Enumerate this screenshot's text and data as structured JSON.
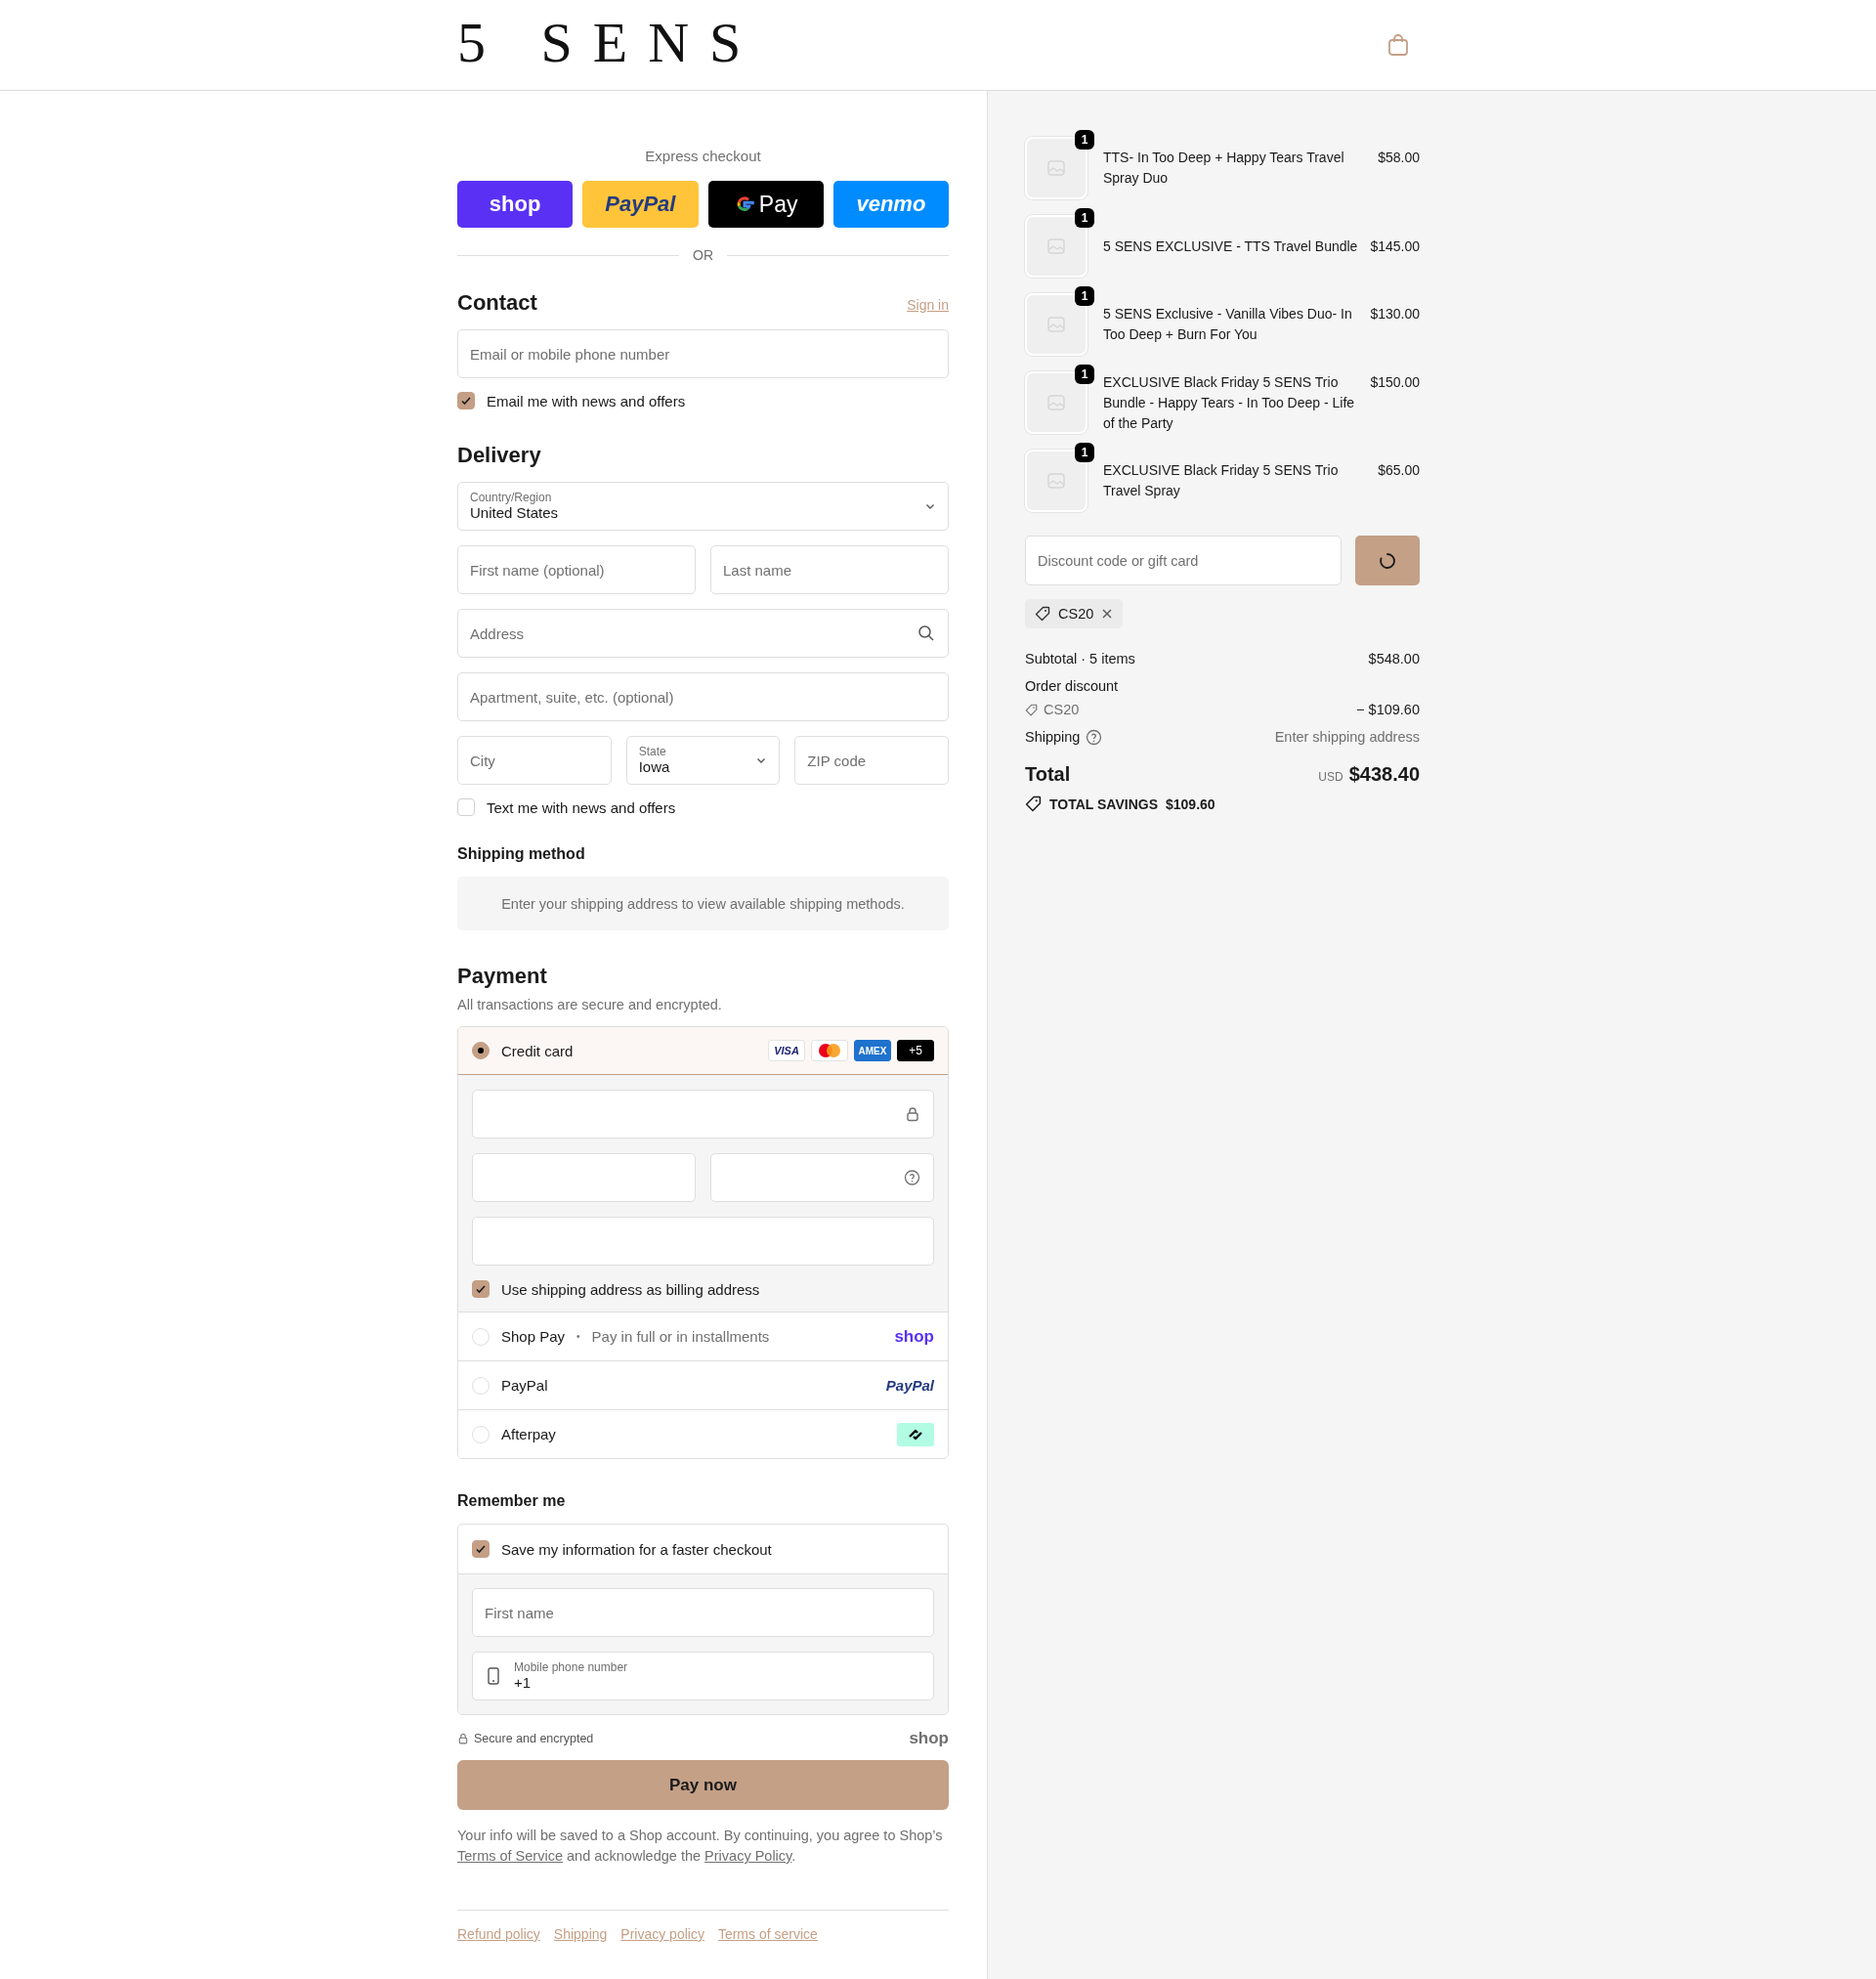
{
  "header": {
    "logo": "5 SENS"
  },
  "express_checkout": {
    "label": "Express checkout",
    "divider": "OR",
    "buttons": [
      {
        "kind": "shop",
        "label": "shop"
      },
      {
        "kind": "paypal",
        "label": "PayPal"
      },
      {
        "kind": "gpay",
        "label": "Pay"
      },
      {
        "kind": "venmo",
        "label": "venmo"
      }
    ]
  },
  "contact": {
    "title": "Contact",
    "sign_in": "Sign in",
    "email": {
      "placeholder": "Email or mobile phone number"
    },
    "news": {
      "label": "Email me with news and offers",
      "checked": true
    }
  },
  "delivery": {
    "title": "Delivery",
    "rows": [
      {
        "fields": [
          {
            "kind": "select",
            "label": "Country/Region",
            "value": "United States"
          }
        ]
      },
      {
        "fields": [
          {
            "kind": "text",
            "placeholder": "First name (optional)"
          },
          {
            "kind": "text",
            "placeholder": "Last name"
          }
        ]
      },
      {
        "fields": [
          {
            "kind": "search",
            "placeholder": "Address"
          }
        ]
      },
      {
        "fields": [
          {
            "kind": "text",
            "placeholder": "Apartment, suite, etc. (optional)"
          }
        ]
      },
      {
        "fields": [
          {
            "kind": "text",
            "placeholder": "City"
          },
          {
            "kind": "select",
            "label": "State",
            "value": "Iowa"
          },
          {
            "kind": "text",
            "placeholder": "ZIP code"
          }
        ]
      }
    ],
    "sms": {
      "label": "Text me with news and offers",
      "checked": false
    }
  },
  "shipping_method": {
    "title": "Shipping method",
    "message": "Enter your shipping address to view available shipping methods."
  },
  "payment": {
    "title": "Payment",
    "subtitle": "All transactions are secure and encrypted.",
    "methods": [
      {
        "kind": "card",
        "label": "Credit card",
        "selected": true,
        "badges": [
          {
            "kind": "visa",
            "text": "VISA"
          },
          {
            "kind": "mastercard"
          },
          {
            "kind": "amex",
            "text": "AMEX"
          },
          {
            "kind": "more",
            "text": "+5"
          }
        ],
        "field_rows": [
          {
            "fields": [
              {
                "kind": "lock"
              }
            ]
          },
          {
            "fields": [
              {
                "kind": "plain"
              },
              {
                "kind": "help"
              }
            ]
          },
          {
            "fields": [
              {
                "kind": "plain"
              }
            ]
          }
        ],
        "billing": {
          "label": "Use shipping address as billing address",
          "checked": true
        }
      },
      {
        "kind": "shop_pay",
        "label": "Shop Pay",
        "selected": false,
        "separator": "•",
        "note": "Pay in full or in installments",
        "logo": "shop"
      },
      {
        "kind": "paypal",
        "label": "PayPal",
        "selected": false,
        "logo": "PayPal"
      },
      {
        "kind": "afterpay",
        "label": "Afterpay",
        "selected": false
      }
    ]
  },
  "remember_me": {
    "title": "Remember me",
    "save": {
      "label": "Save my information for a faster checkout",
      "checked": true
    },
    "first_name": {
      "placeholder": "First name"
    },
    "phone": {
      "label": "Mobile phone number",
      "value": "+1"
    },
    "secure": "Secure and encrypted",
    "shop_logo": "shop"
  },
  "pay_button": "Pay now",
  "disclaimer": [
    {
      "kind": "text",
      "text": "Your info will be saved to a Shop account. By continuing, you agree to Shop’s "
    },
    {
      "kind": "link",
      "text": "Terms of Service"
    },
    {
      "kind": "text",
      "text": " and acknowledge the "
    },
    {
      "kind": "link",
      "text": "Privacy Policy"
    },
    {
      "kind": "text",
      "text": "."
    }
  ],
  "footer_links": [
    "Refund policy",
    "Shipping",
    "Privacy policy",
    "Terms of service"
  ],
  "summary": {
    "items": [
      {
        "name": "TTS- In Too Deep + Happy Tears Travel Spray Duo",
        "price": "$58.00",
        "quantity": "1"
      },
      {
        "name": "5 SENS EXCLUSIVE - TTS Travel Bundle",
        "price": "$145.00",
        "quantity": "1"
      },
      {
        "name": "5 SENS Exclusive - Vanilla Vibes Duo- In Too Deep + Burn For You",
        "price": "$130.00",
        "quantity": "1"
      },
      {
        "name": "EXCLUSIVE Black Friday 5 SENS Trio Bundle - Happy Tears - In Too Deep - Life of the Party",
        "price": "$150.00",
        "quantity": "1"
      },
      {
        "name": "EXCLUSIVE Black Friday 5 SENS Trio Travel Spray",
        "price": "$65.00",
        "quantity": "1"
      }
    ],
    "discount": {
      "placeholder": "Discount code or gift card",
      "applied_code": "CS20"
    },
    "subtotal": {
      "label": "Subtotal · 5 items",
      "value": "$548.00"
    },
    "order_discount": {
      "label": "Order discount",
      "code": "CS20",
      "value": "− $109.60"
    },
    "shipping": {
      "label": "Shipping",
      "value": "Enter shipping address"
    },
    "total": {
      "label": "Total",
      "currency": "USD",
      "value": "$438.40"
    },
    "savings": {
      "label": "TOTAL SAVINGS",
      "value": "$109.60"
    }
  }
}
